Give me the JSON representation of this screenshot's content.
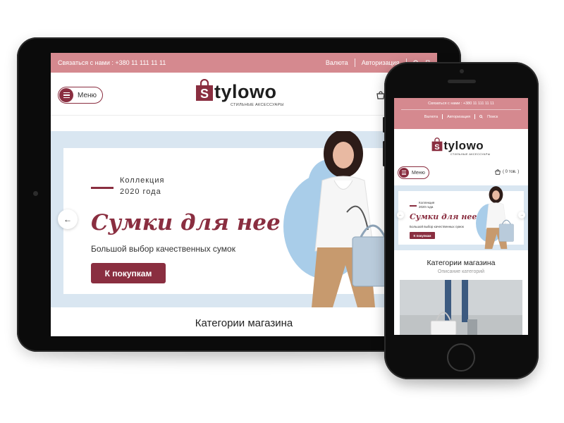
{
  "brand": {
    "name": "Stylowo",
    "tagline": "СТИЛЬНЫЕ АКСЕССУАРЫ",
    "accent": "#8a2e40",
    "topbar_color": "#d5898f"
  },
  "topbar": {
    "contact": "Связаться с нами :  +380 11 111 11 11",
    "currency": "Валюта",
    "login": "Авторизация",
    "search": "Поиск",
    "search_letter": "П"
  },
  "header": {
    "menu_label": "Меню",
    "cart_icon": "cart-icon",
    "cart_status": "( 0 тов. )"
  },
  "hero": {
    "collection_line1": "Коллекция",
    "collection_line2": "2020 года",
    "title": "Сумки для нее",
    "subtitle": "Большой выбор качественных сумок",
    "cta": "К покупкам"
  },
  "categories": {
    "title": "Категории магазина",
    "subtitle": "Описание категорий"
  }
}
